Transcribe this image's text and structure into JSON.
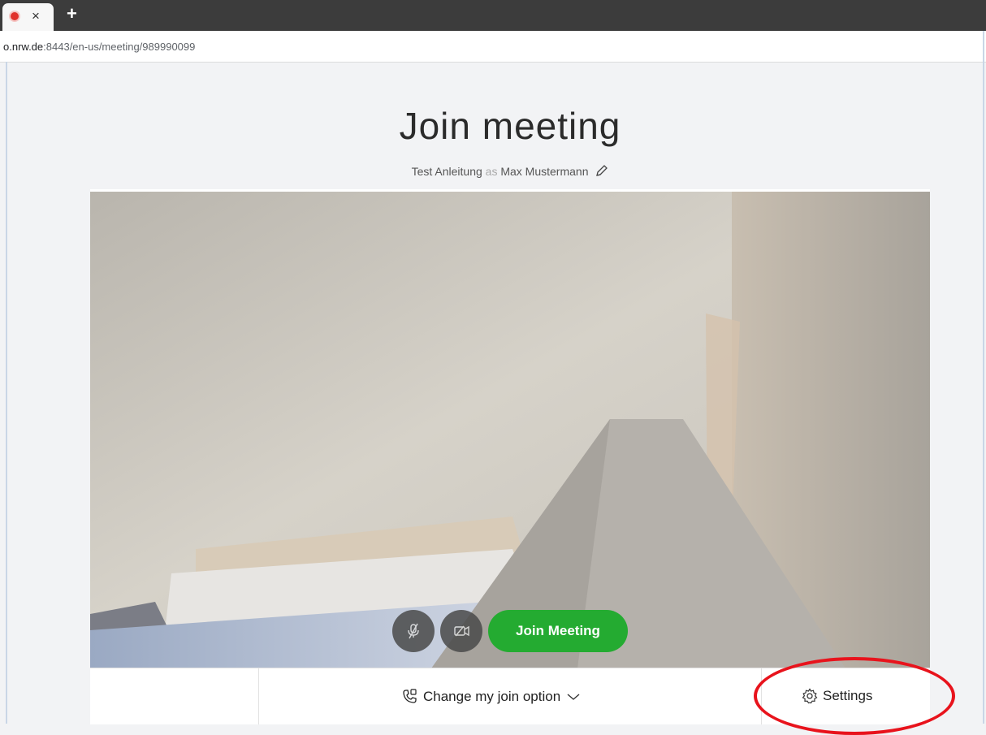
{
  "browser": {
    "tab_close_glyph": "×",
    "new_tab_glyph": "+",
    "url_host": "o.nrw.de",
    "url_path": ":8443/en-us/meeting/989990099"
  },
  "page": {
    "title": "Join meeting",
    "meeting_name": "Test Anleitung",
    "as_word": "as",
    "user_name": "Max Mustermann"
  },
  "controls": {
    "join_button_label": "Join Meeting",
    "change_join_option_label": "Change my join option",
    "settings_label": "Settings"
  },
  "icons": {
    "recording": "record-dot-icon",
    "mic": "microphone-muted-icon",
    "camera": "camera-off-icon",
    "edit": "pencil-icon",
    "join_option": "phone-join-icon",
    "chevron": "chevron-down-icon",
    "settings": "gear-icon"
  },
  "colors": {
    "join_button": "#24ab31",
    "highlight_annotation": "#e8131c",
    "control_bg": "#4a4a4a"
  }
}
